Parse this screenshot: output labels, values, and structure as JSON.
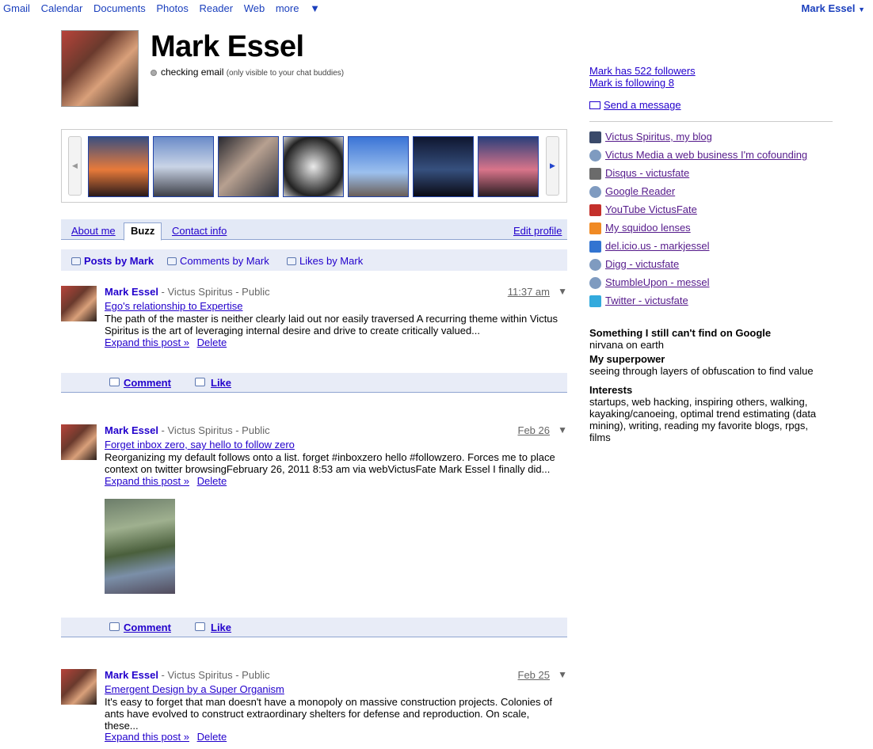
{
  "topnav": {
    "links": [
      "Gmail",
      "Calendar",
      "Documents",
      "Photos",
      "Reader",
      "Web"
    ],
    "more": "more",
    "user": "Mark Essel"
  },
  "profile": {
    "name": "Mark Essel",
    "status": "checking email",
    "status_note": "(only visible to your chat buddies)"
  },
  "tabs": {
    "about": "About me",
    "buzz": "Buzz",
    "contact": "Contact info",
    "edit": "Edit profile"
  },
  "subtabs": {
    "posts": "Posts by Mark",
    "comments": "Comments by Mark",
    "likes": "Likes by Mark"
  },
  "actions": {
    "comment": "Comment",
    "like": "Like",
    "expand": "Expand this post »",
    "delete": "Delete"
  },
  "posts": [
    {
      "author": "Mark Essel",
      "meta": " - Victus Spiritus - Public",
      "time": "11:37 am",
      "title": "Ego's relationship to Expertise",
      "body": "The path of the master is neither clearly laid out nor easily traversed A recurring theme within Victus Spiritus is the art of leveraging internal desire and drive to create critically valued..."
    },
    {
      "author": "Mark Essel",
      "meta": " - Victus Spiritus - Public",
      "time": "Feb 26",
      "title": "Forget inbox zero, say hello to follow zero",
      "body": "Reorganizing my default follows onto a list. forget #inboxzero hello #followzero. Forces me to place context on twitter browsingFebruary 26, 2011 8:53 am via webVictusFate Mark Essel I finally did..."
    },
    {
      "author": "Mark Essel",
      "meta": " - Victus Spiritus - Public",
      "time": "Feb 25",
      "title": "Emergent Design by a Super Organism",
      "body": "It's easy to forget that man doesn't have a monopoly on massive construction projects. Colonies of ants have evolved to construct extraordinary shelters for defense and reproduction. On scale, these..."
    }
  ],
  "sidebar": {
    "followers": "Mark has 522 followers",
    "following": "Mark is following 8",
    "send": "Send a message",
    "links": [
      {
        "label": "Victus Spiritus, my blog",
        "icon": "blog-icon",
        "color": "#3a4a6a"
      },
      {
        "label": "Victus Media a web business I'm cofounding",
        "icon": "globe-icon",
        "color": "#7f9bc0"
      },
      {
        "label": "Disqus - victusfate",
        "icon": "disqus-icon",
        "color": "#6b6b6b"
      },
      {
        "label": "Google Reader",
        "icon": "globe-icon",
        "color": "#7f9bc0"
      },
      {
        "label": "YouTube VictusFate",
        "icon": "youtube-icon",
        "color": "#c4302b"
      },
      {
        "label": "My squidoo lenses",
        "icon": "squidoo-icon",
        "color": "#f08a24"
      },
      {
        "label": "del.icio.us - markjessel",
        "icon": "delicious-icon",
        "color": "#3274d1"
      },
      {
        "label": "Digg - victusfate",
        "icon": "globe-icon",
        "color": "#7f9bc0"
      },
      {
        "label": "StumbleUpon - messel",
        "icon": "globe-icon",
        "color": "#7f9bc0"
      },
      {
        "label": "Twitter - victusfate",
        "icon": "twitter-icon",
        "color": "#33aadd"
      }
    ],
    "qa": [
      {
        "q": "Something I still can't find on Google",
        "a": "nirvana on earth"
      },
      {
        "q": "My superpower",
        "a": "seeing through layers of obfuscation to find value"
      },
      {
        "q": "Interests",
        "a": "startups, web hacking, inspiring others, walking, kayaking/canoeing, optimal trend estimating (data mining), writing, reading my favorite blogs, rpgs, films"
      }
    ]
  },
  "thumbs": [
    "#c15a2a",
    "#7d8fb5",
    "#5a6070",
    "#cfcfcf",
    "#4b7ad0",
    "#1b2540",
    "#b96060"
  ]
}
